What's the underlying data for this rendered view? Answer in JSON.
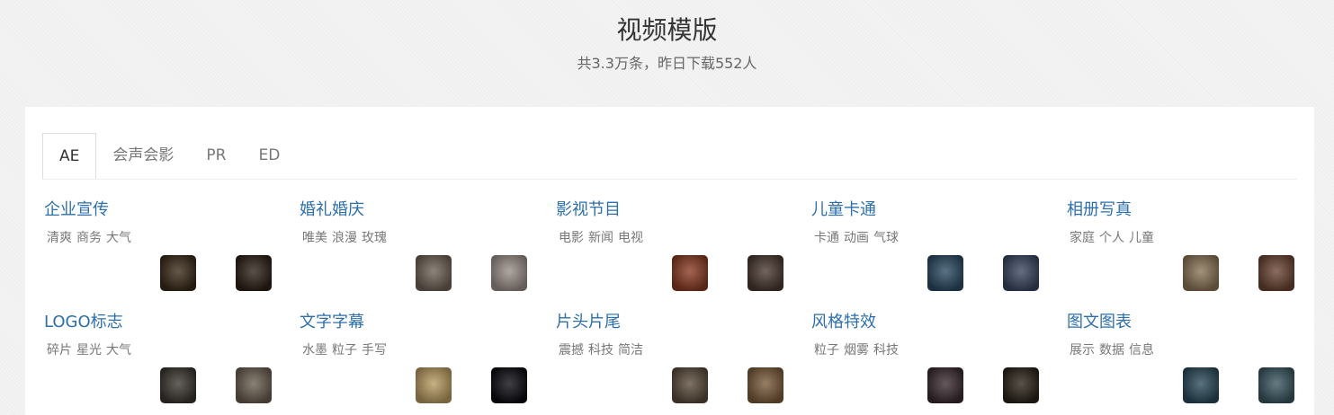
{
  "page": {
    "title": "视频模版",
    "subtitle": "共3.3万条，昨日下载552人"
  },
  "tabs": [
    {
      "label": "AE",
      "active": true
    },
    {
      "label": "会声会影",
      "active": false
    },
    {
      "label": "PR",
      "active": false
    },
    {
      "label": "ED",
      "active": false
    }
  ],
  "categories": [
    {
      "title": "企业宣传",
      "tags": [
        "清爽",
        "商务",
        "大气"
      ],
      "thumbs": [
        {
          "bg": "#3a2a18"
        },
        {
          "bg": "#2c2016"
        }
      ]
    },
    {
      "title": "婚礼婚庆",
      "tags": [
        "唯美",
        "浪漫",
        "玫瑰"
      ],
      "thumbs": [
        {
          "bg": "#6e6256"
        },
        {
          "bg": "#9a8f88"
        }
      ]
    },
    {
      "title": "影视节目",
      "tags": [
        "电影",
        "新闻",
        "电视"
      ],
      "thumbs": [
        {
          "bg": "#8a3a22"
        },
        {
          "bg": "#4a3830"
        }
      ]
    },
    {
      "title": "儿童卡通",
      "tags": [
        "卡通",
        "动画",
        "气球"
      ],
      "thumbs": [
        {
          "bg": "#2a4a62"
        },
        {
          "bg": "#3a4660"
        }
      ]
    },
    {
      "title": "相册写真",
      "tags": [
        "家庭",
        "个人",
        "儿童"
      ],
      "thumbs": [
        {
          "bg": "#8a7456"
        },
        {
          "bg": "#6a4432"
        }
      ]
    },
    {
      "title": "LOGO标志",
      "tags": [
        "碎片",
        "星光",
        "大气"
      ],
      "thumbs": [
        {
          "bg": "#3a3630"
        },
        {
          "bg": "#6a5e50"
        }
      ]
    },
    {
      "title": "文字字幕",
      "tags": [
        "水墨",
        "粒子",
        "手写"
      ],
      "thumbs": [
        {
          "bg": "#b89a60"
        },
        {
          "bg": "#0a0a10"
        }
      ]
    },
    {
      "title": "片头片尾",
      "tags": [
        "震撼",
        "科技",
        "简洁"
      ],
      "thumbs": [
        {
          "bg": "#5a4a3a"
        },
        {
          "bg": "#7a5a3a"
        }
      ]
    },
    {
      "title": "风格特效",
      "tags": [
        "粒子",
        "烟雾",
        "科技"
      ],
      "thumbs": [
        {
          "bg": "#3a2a30"
        },
        {
          "bg": "#2a2218"
        }
      ]
    },
    {
      "title": "图文图表",
      "tags": [
        "展示",
        "数据",
        "信息"
      ],
      "thumbs": [
        {
          "bg": "#2a4a5a"
        },
        {
          "bg": "#3a5660"
        }
      ]
    }
  ]
}
